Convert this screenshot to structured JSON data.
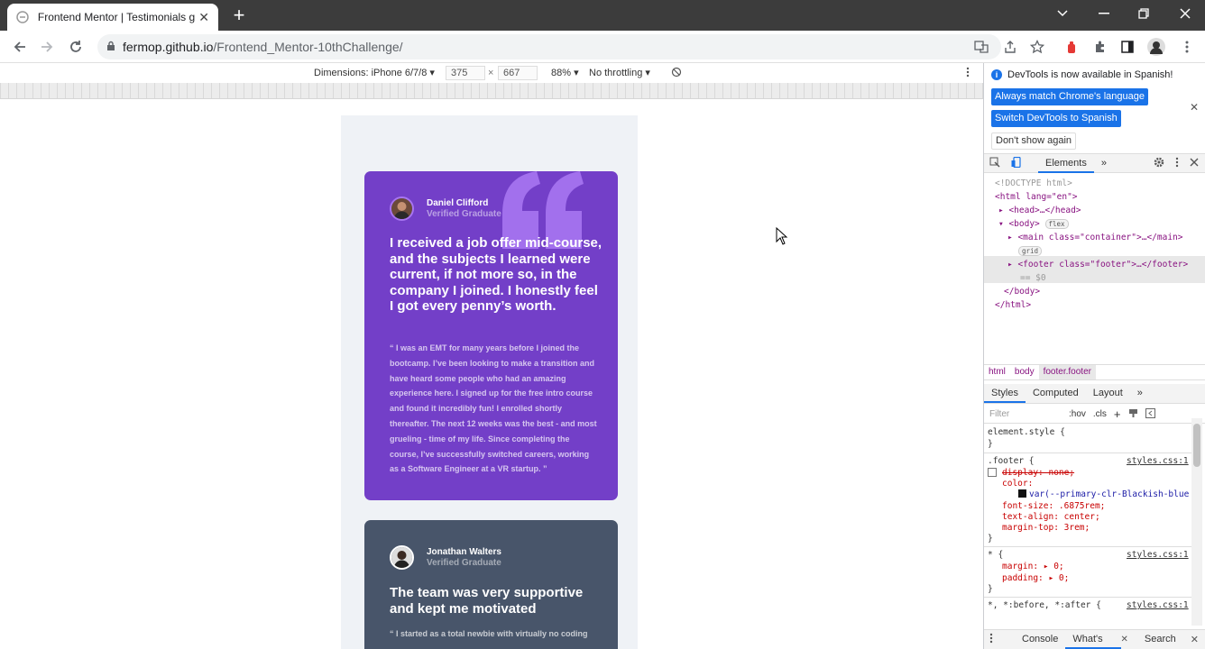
{
  "browser": {
    "tab_title": "Frontend Mentor | Testimonials g",
    "url_host": "fermop.github.io",
    "url_path": "/Frontend_Mentor-10thChallenge/"
  },
  "device_toolbar": {
    "device": "Dimensions: iPhone 6/7/8 ▾",
    "width": "375",
    "times": "×",
    "height": "667",
    "zoom": "88% ▾",
    "throttling": "No throttling ▾"
  },
  "testimonials": [
    {
      "name": "Daniel Clifford",
      "status": "Verified Graduate",
      "headline": "I received a job offer mid-course, and the subjects I learned were current, if not more so, in the company I joined. I honestly feel I got every penny’s worth.",
      "body": "“ I was an EMT for many years before I joined the bootcamp. I’ve been looking to make a transition and have heard some people who had an amazing experience here. I signed up for the free intro course and found it incredibly fun! I enrolled shortly thereafter. The next 12 weeks was the best - and most grueling - time of my life. Since completing the course, I’ve successfully switched careers, working as a Software Engineer at a VR startup. ”",
      "color": "#733fc8"
    },
    {
      "name": "Jonathan Walters",
      "status": "Verified Graduate",
      "headline": "The team was very supportive and kept me motivated",
      "body": "“ I started as a total newbie with virtually no coding",
      "color": "#48556a"
    }
  ],
  "devtools": {
    "info_message": "DevTools is now available in Spanish!",
    "btn_match": "Always match Chrome's language",
    "btn_switch": "Switch DevTools to Spanish",
    "btn_dont_show": "Don't show again",
    "tabs": [
      "Elements",
      "»"
    ],
    "dom": {
      "doctype": "<!DOCTYPE html>",
      "html_open": "<html lang=\"en\">",
      "head": "<head>…</head>",
      "body_open": "<body>",
      "flex_badge": "flex",
      "main": "<main class=\"container\">…</main>",
      "grid_badge": "grid",
      "footer": "<footer class=\"footer\">…</footer>",
      "footer_ref": "== $0",
      "body_close": "</body>",
      "html_close": "</html>"
    },
    "breadcrumbs": [
      "html",
      "body",
      "footer.footer"
    ],
    "styles_tabs": [
      "Styles",
      "Computed",
      "Layout",
      "»"
    ],
    "filter_placeholder": "Filter",
    "filter_tools": [
      ":hov",
      ".cls",
      "+"
    ],
    "css": {
      "element_style": "element.style {",
      "close": "}",
      "footer_selector": ".footer {",
      "footer_source": "styles.css:1",
      "display": "display: none;",
      "color_prop": "color:",
      "color_val": "var(--primary-clr-Blackish-blue",
      "font_size": "font-size: .6875rem;",
      "text_align": "text-align: center;",
      "margin_top": "margin-top: 3rem;",
      "star_selector": "* {",
      "star_source": "styles.css:1",
      "margin": "margin: ▸ 0;",
      "padding": "padding: ▸ 0;",
      "before_after": "*, *:before, *:after {",
      "before_source": "styles.css:1"
    },
    "drawer": [
      "Console",
      "What's New",
      "Search"
    ]
  }
}
